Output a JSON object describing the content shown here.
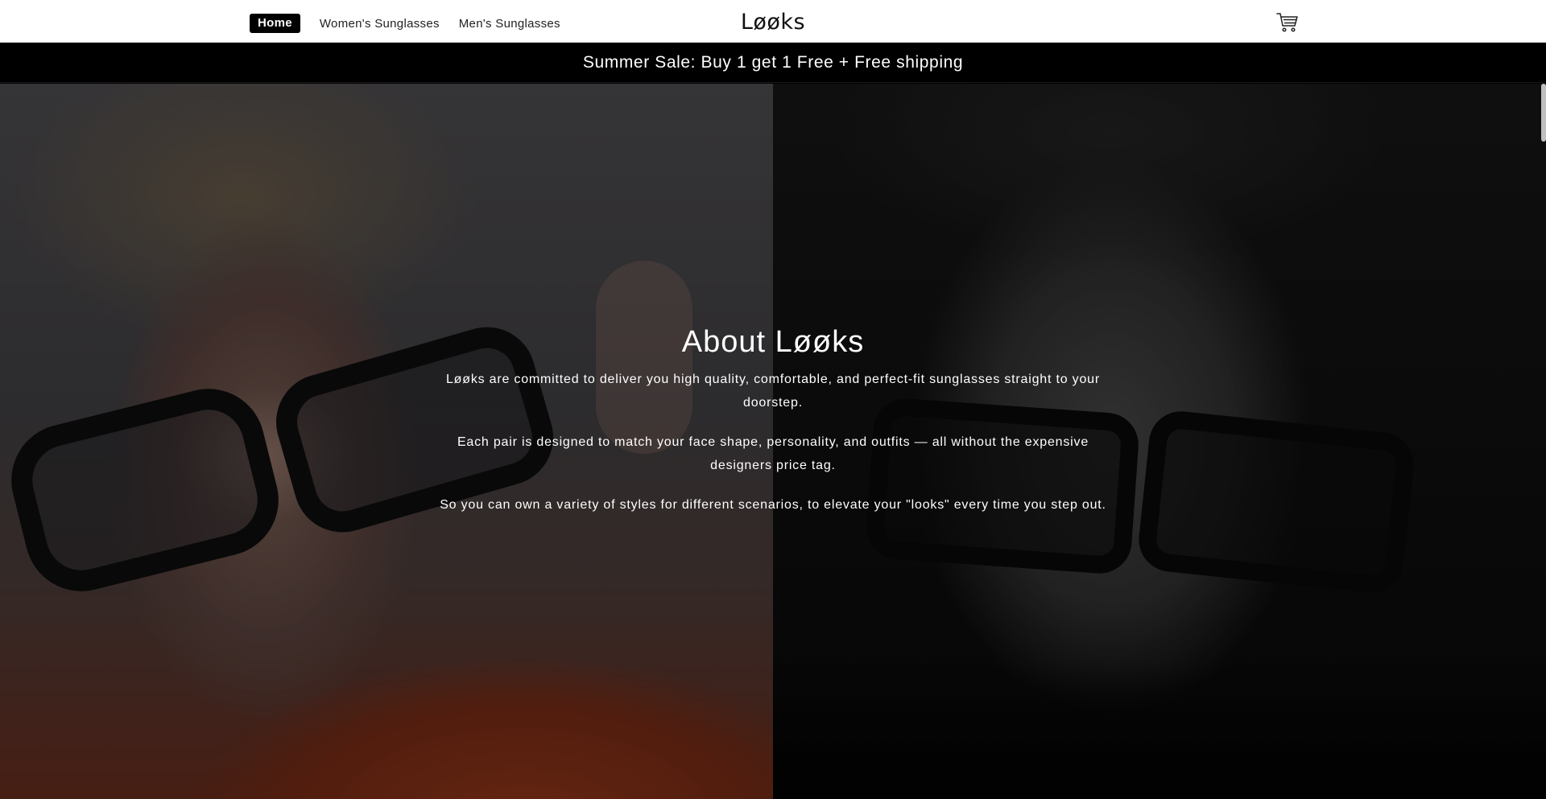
{
  "header": {
    "nav": [
      {
        "label": "Home",
        "active": true
      },
      {
        "label": "Women's Sunglasses",
        "active": false
      },
      {
        "label": "Men's Sunglasses",
        "active": false
      }
    ],
    "logo": "Løøks",
    "cart_icon": "cart-icon"
  },
  "announcement": {
    "text": "Summer Sale: Buy 1 get 1 Free + Free shipping"
  },
  "hero": {
    "title": "About Løøks",
    "paragraphs": [
      "Løøks are committed to deliver you high quality, comfortable, and perfect-fit sunglasses straight to your doorstep.",
      "Each pair is designed to match your face shape, personality, and outfits — all without the expensive designers price tag.",
      "So you can own a variety of styles for different scenarios, to elevate your \"looks\" every time you step out."
    ]
  },
  "colors": {
    "header_bg": "#ffffff",
    "announce_bg": "#000000",
    "accent_text": "#ffffff",
    "shirt": "#b0421f"
  }
}
